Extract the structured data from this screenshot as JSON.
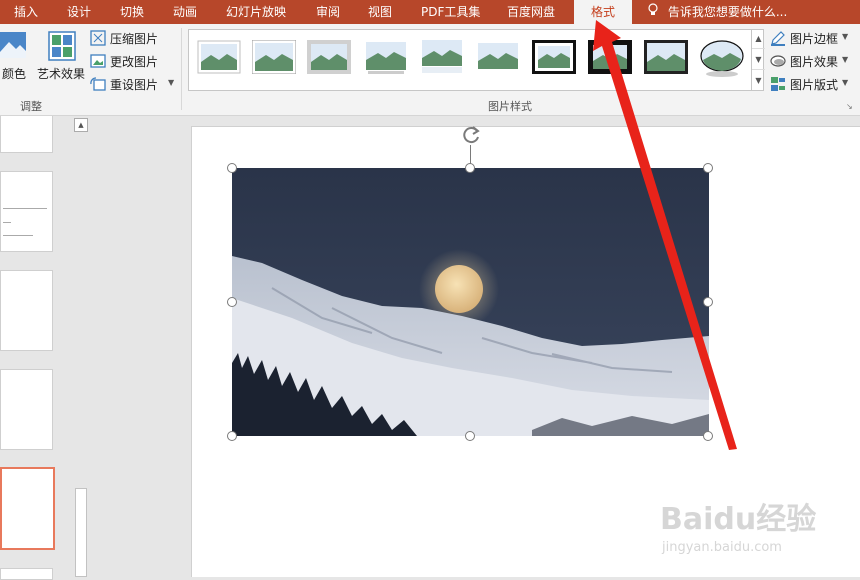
{
  "tabs": [
    {
      "label": "插入"
    },
    {
      "label": "设计"
    },
    {
      "label": "切换"
    },
    {
      "label": "动画"
    },
    {
      "label": "幻灯片放映"
    },
    {
      "label": "审阅"
    },
    {
      "label": "视图"
    },
    {
      "label": "PDF工具集"
    },
    {
      "label": "百度网盘"
    },
    {
      "label": "格式"
    }
  ],
  "active_tab": "格式",
  "tell_me": {
    "placeholder": "告诉我您想要做什么..."
  },
  "adjust_group": {
    "color_label": "颜色",
    "artistic_label": "艺术效果",
    "compress_label": "压缩图片",
    "change_label": "更改图片",
    "reset_label": "重设图片",
    "group_name": "调整"
  },
  "styles_group": {
    "group_name": "图片样式",
    "border_label": "图片边框",
    "effects_label": "图片效果",
    "layout_label": "图片版式"
  },
  "watermark": {
    "brand": "Baidu经验",
    "url": "jingyan.baidu.com"
  },
  "colors": {
    "tab_bar": "#b7472a",
    "active_tab_text": "#c43e1c",
    "arrow": "#e8231a",
    "selected_slide_border": "#e8795c"
  }
}
